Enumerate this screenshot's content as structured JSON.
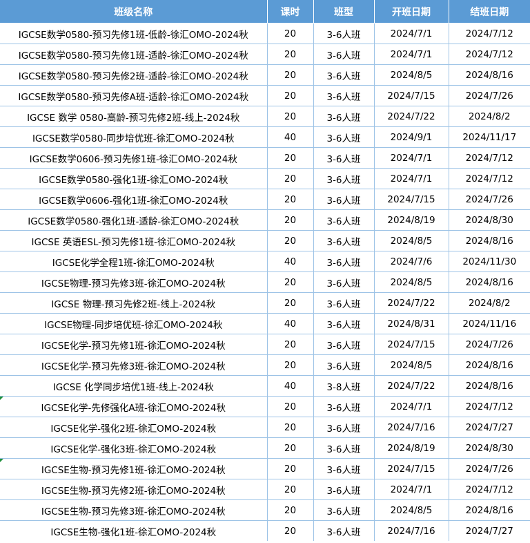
{
  "columns": [
    "班级名称",
    "课时",
    "班型",
    "开班日期",
    "结班日期"
  ],
  "rows": [
    [
      "IGCSE数学0580-预习先修1班-低龄-徐汇OMO-2024秋",
      "20",
      "3-6人班",
      "2024/7/1",
      "2024/7/12"
    ],
    [
      "IGCSE数学0580-预习先修1班-适龄-徐汇OMO-2024秋",
      "20",
      "3-6人班",
      "2024/7/1",
      "2024/7/12"
    ],
    [
      "IGCSE数学0580-预习先修2班-适龄-徐汇OMO-2024秋",
      "20",
      "3-6人班",
      "2024/8/5",
      "2024/8/16"
    ],
    [
      "IGCSE数学0580-预习先修A班-适龄-徐汇OMO-2024秋",
      "20",
      "3-6人班",
      "2024/7/15",
      "2024/7/26"
    ],
    [
      "IGCSE 数学 0580-高龄-预习先修2班-线上-2024秋",
      "20",
      "3-6人班",
      "2024/7/22",
      "2024/8/2"
    ],
    [
      "IGCSE数学0580-同步培优班-徐汇OMO-2024秋",
      "40",
      "3-6人班",
      "2024/9/1",
      "2024/11/17"
    ],
    [
      "IGCSE数学0606-预习先修1班-徐汇OMO-2024秋",
      "20",
      "3-6人班",
      "2024/7/1",
      "2024/7/12"
    ],
    [
      "IGCSE数学0580-强化1班-徐汇OMO-2024秋",
      "20",
      "3-6人班",
      "2024/7/1",
      "2024/7/12"
    ],
    [
      "IGCSE数学0606-强化1班-徐汇OMO-2024秋",
      "20",
      "3-6人班",
      "2024/7/15",
      "2024/7/26"
    ],
    [
      "IGCSE数学0580-强化1班-适龄-徐汇OMO-2024秋",
      "20",
      "3-6人班",
      "2024/8/19",
      "2024/8/30"
    ],
    [
      "IGCSE 英语ESL-预习先修1班-徐汇OMO-2024秋",
      "20",
      "3-6人班",
      "2024/8/5",
      "2024/8/16"
    ],
    [
      "IGCSE化学全程1班-徐汇OMO-2024秋",
      "40",
      "3-6人班",
      "2024/7/6",
      "2024/11/30"
    ],
    [
      "IGCSE物理-预习先修3班-徐汇OMO-2024秋",
      "20",
      "3-6人班",
      "2024/8/5",
      "2024/8/16"
    ],
    [
      "IGCSE 物理-预习先修2班-线上-2024秋",
      "20",
      "3-6人班",
      "2024/7/22",
      "2024/8/2"
    ],
    [
      "IGCSE物理-同步培优班-徐汇OMO-2024秋",
      "40",
      "3-6人班",
      "2024/8/31",
      "2024/11/16"
    ],
    [
      "IGCSE化学-预习先修1班-徐汇OMO-2024秋",
      "20",
      "3-6人班",
      "2024/7/15",
      "2024/7/26"
    ],
    [
      "IGCSE化学-预习先修3班-徐汇OMO-2024秋",
      "20",
      "3-6人班",
      "2024/8/5",
      "2024/8/16"
    ],
    [
      "IGCSE 化学同步培优1班-线上-2024秋",
      "40",
      "3-8人班",
      "2024/7/22",
      "2024/8/16"
    ],
    [
      "IGCSE化学-先修强化A班-徐汇OMO-2024秋",
      "20",
      "3-6人班",
      "2024/7/1",
      "2024/7/12"
    ],
    [
      "IGCSE化学-强化2班-徐汇OMO-2024秋",
      "20",
      "3-6人班",
      "2024/7/16",
      "2024/7/27"
    ],
    [
      "IGCSE化学-强化3班-徐汇OMO-2024秋",
      "20",
      "3-6人班",
      "2024/8/19",
      "2024/8/30"
    ],
    [
      "IGCSE生物-预习先修1班-徐汇OMO-2024秋",
      "20",
      "3-6人班",
      "2024/7/15",
      "2024/7/26"
    ],
    [
      "IGCSE生物-预习先修2班-徐汇OMO-2024秋",
      "20",
      "3-6人班",
      "2024/7/1",
      "2024/7/12"
    ],
    [
      "IGCSE生物-预习先修3班-徐汇OMO-2024秋",
      "20",
      "3-6人班",
      "2024/8/5",
      "2024/8/16"
    ],
    [
      "IGCSE生物-强化1班-徐汇OMO-2024秋",
      "20",
      "3-6人班",
      "2024/7/16",
      "2024/7/27"
    ]
  ],
  "comment_marker_rows": [
    18,
    21
  ],
  "colors": {
    "header_bg": "#5b9bd5",
    "header_text": "#ffffff",
    "grid_line": "#9dc3e6",
    "comment_marker": "#1e8f3a"
  }
}
